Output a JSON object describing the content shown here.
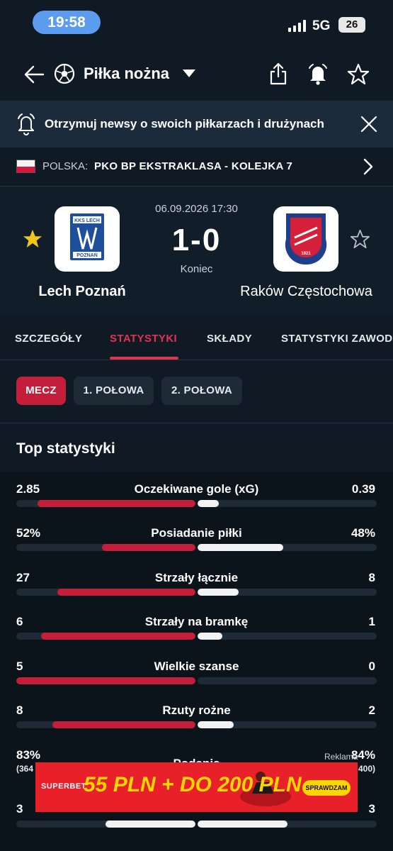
{
  "status_bar": {
    "time": "19:58",
    "network": "5G",
    "battery": "26"
  },
  "header": {
    "title": "Piłka nożna"
  },
  "news_banner": {
    "text": "Otrzymuj newsy o swoich piłkarzach i drużynach"
  },
  "league": {
    "country": "POLSKA:",
    "name": "PKO BP EKSTRAKLASA - KOLEJKA 7"
  },
  "match": {
    "datetime": "06.09.2026 17:30",
    "score": "1-0",
    "status": "Koniec",
    "home": {
      "name": "Lech Poznań",
      "favorite": true
    },
    "away": {
      "name": "Raków Częstochowa",
      "favorite": false
    }
  },
  "tabs": [
    "SZCZEGÓŁY",
    "STATYSTYKI",
    "SKŁADY",
    "STATYSTYKI ZAWOD"
  ],
  "active_tab": "STATYSTYKI",
  "periods": [
    "MECZ",
    "1. POŁOWA",
    "2. POŁOWA"
  ],
  "active_period": "MECZ",
  "section_title": "Top statystyki",
  "stats": [
    {
      "name": "Oczekiwane gole (xG)",
      "home": "2.85",
      "away": "0.39",
      "home_share": 0.88,
      "away_share": 0.12,
      "home_winner": true
    },
    {
      "name": "Posiadanie piłki",
      "home": "52%",
      "away": "48%",
      "home_share": 0.52,
      "away_share": 0.48,
      "home_winner": true
    },
    {
      "name": "Strzały łącznie",
      "home": "27",
      "away": "8",
      "home_share": 0.77,
      "away_share": 0.23,
      "home_winner": true
    },
    {
      "name": "Strzały na bramkę",
      "home": "6",
      "away": "1",
      "home_share": 0.86,
      "away_share": 0.14,
      "home_winner": true
    },
    {
      "name": "Wielkie szanse",
      "home": "5",
      "away": "0",
      "home_share": 1.0,
      "away_share": 0.0,
      "home_winner": true
    },
    {
      "name": "Rzuty rożne",
      "home": "8",
      "away": "2",
      "home_share": 0.8,
      "away_share": 0.2,
      "home_winner": true
    },
    {
      "name": "Podania",
      "home": "83%",
      "away": "84%",
      "home_sub": "(364",
      "away_sub": "400)"
    },
    {
      "name": "",
      "home": "3",
      "away": "3",
      "home_share": 0.5,
      "away_share": 0.5,
      "home_winner": false
    }
  ],
  "ad": {
    "label": "Reklama",
    "brand": "SUPERBET",
    "offer": "55 PLN + DO 200 PLN",
    "cta": "SPRAWDZAM"
  },
  "colors": {
    "accent": "#e0344f",
    "bar_home": "#c41e3a",
    "bar_away": "#f2f2f2",
    "track": "#1e2a36",
    "background": "#0f1a24"
  }
}
